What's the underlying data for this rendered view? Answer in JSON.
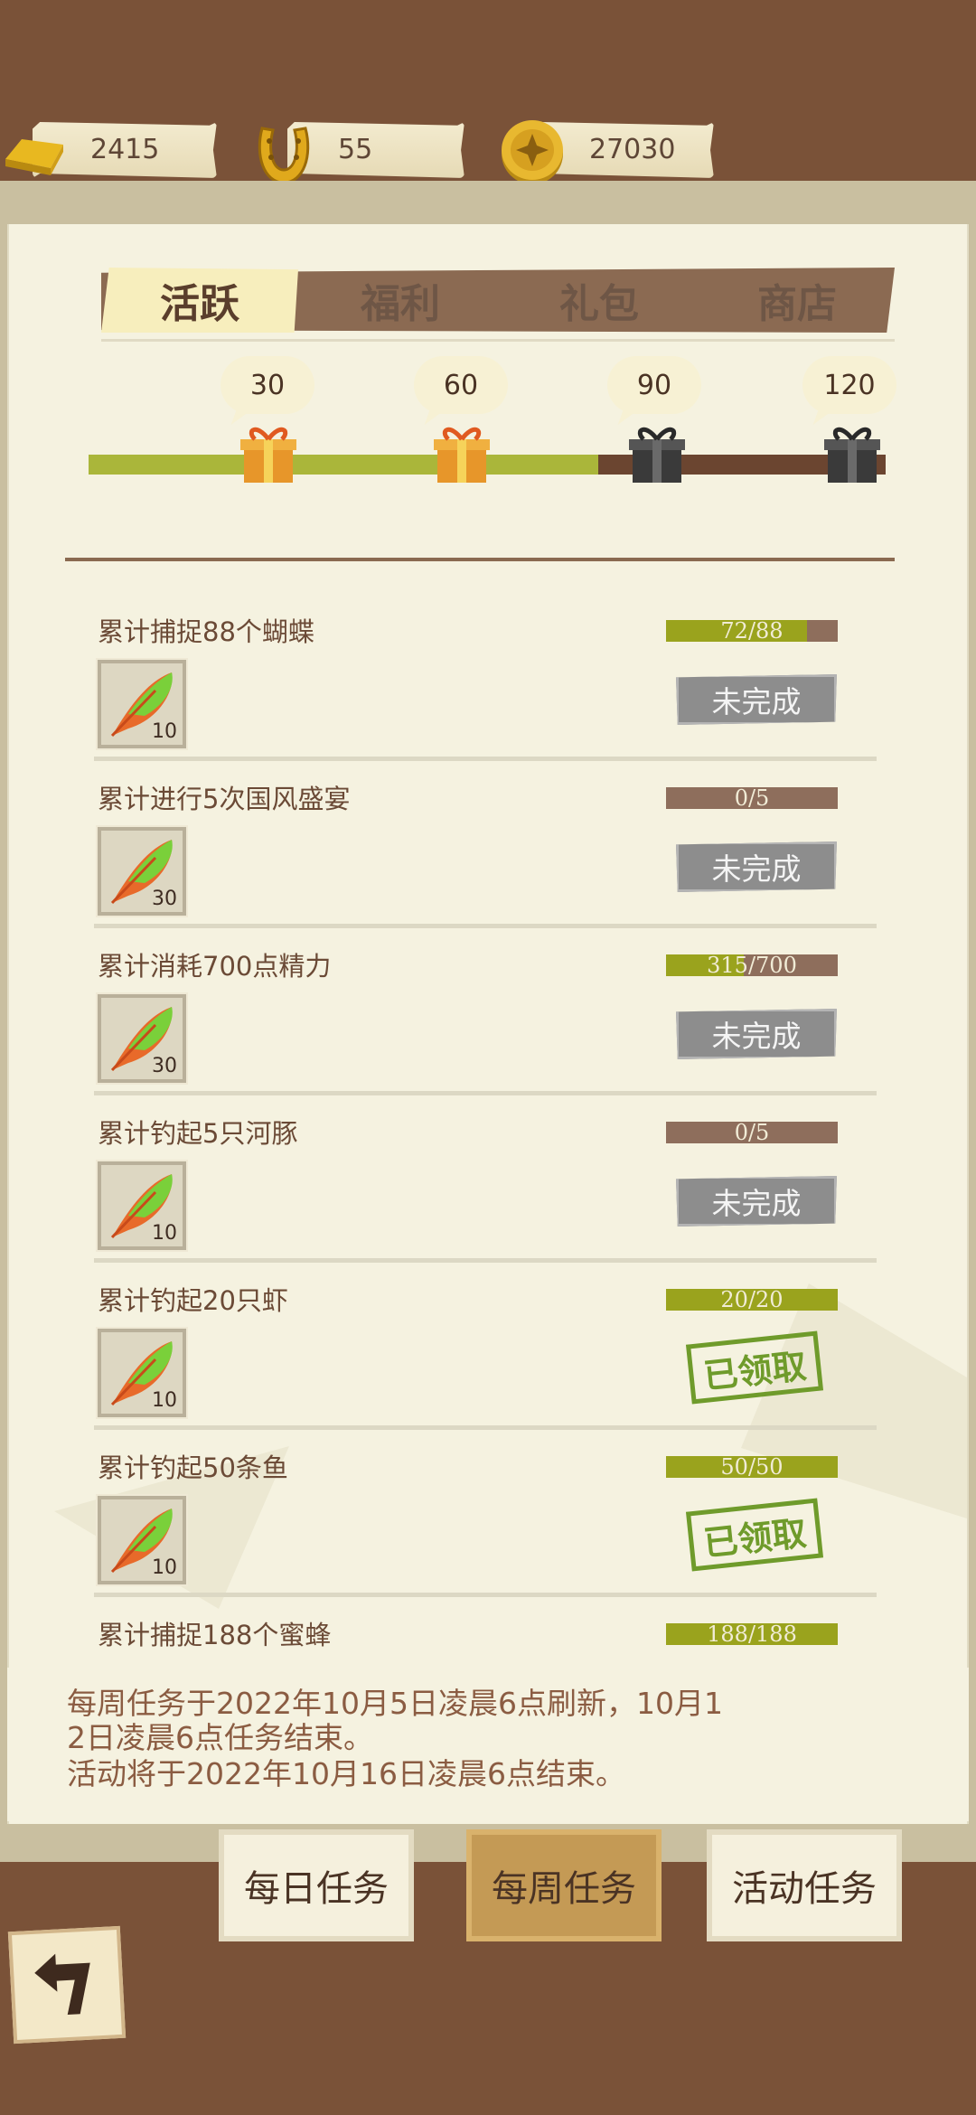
{
  "currencies": [
    {
      "icon": "gold-bar-icon",
      "value": "2415"
    },
    {
      "icon": "horseshoe-icon",
      "value": "55"
    },
    {
      "icon": "coin-icon",
      "value": "27030"
    }
  ],
  "tabs": [
    {
      "label": "活跃",
      "active": true
    },
    {
      "label": "福利",
      "active": false
    },
    {
      "label": "礼包",
      "active": false
    },
    {
      "label": "商店",
      "active": false
    }
  ],
  "milestones": [
    {
      "points": "30",
      "reached": true
    },
    {
      "points": "60",
      "reached": true
    },
    {
      "points": "90",
      "reached": false
    },
    {
      "points": "120",
      "reached": false
    }
  ],
  "milestone_progress": 0.64,
  "tasks": [
    {
      "title": "累计捕捉88个蝴蝶",
      "progress_text": "72/88",
      "progress": 0.82,
      "reward_count": "10",
      "status": "未完成",
      "claimed": false
    },
    {
      "title": "累计进行5次国风盛宴",
      "progress_text": "0/5",
      "progress": 0.0,
      "reward_count": "30",
      "status": "未完成",
      "claimed": false
    },
    {
      "title": "累计消耗700点精力",
      "progress_text": "315/700",
      "progress": 0.45,
      "reward_count": "30",
      "status": "未完成",
      "claimed": false
    },
    {
      "title": "累计钓起5只河豚",
      "progress_text": "0/5",
      "progress": 0.0,
      "reward_count": "10",
      "status": "未完成",
      "claimed": false
    },
    {
      "title": "累计钓起20只虾",
      "progress_text": "20/20",
      "progress": 1.0,
      "reward_count": "10",
      "status": "已领取",
      "claimed": true
    },
    {
      "title": "累计钓起50条鱼",
      "progress_text": "50/50",
      "progress": 1.0,
      "reward_count": "10",
      "status": "已领取",
      "claimed": true
    },
    {
      "title": "累计捕捉188个蜜蜂",
      "progress_text": "188/188",
      "progress": 1.0
    }
  ],
  "notice": {
    "line1": "每周任务于2022年10月5日凌晨6点刷新，10月1",
    "line2": "2日凌晨6点任务结束。",
    "line3": "活动将于2022年10月16日凌晨6点结束。"
  },
  "bottom_nav": [
    {
      "label": "每日任务",
      "active": false
    },
    {
      "label": "每周任务",
      "active": true
    },
    {
      "label": "活动任务",
      "active": false
    }
  ],
  "colors": {
    "background": "#7a5238",
    "paper": "#f5f2e0",
    "progress_fill": "#9aa31d",
    "claimed_stamp": "#6f9b2b",
    "incomplete_button": "#8d8d8d"
  }
}
